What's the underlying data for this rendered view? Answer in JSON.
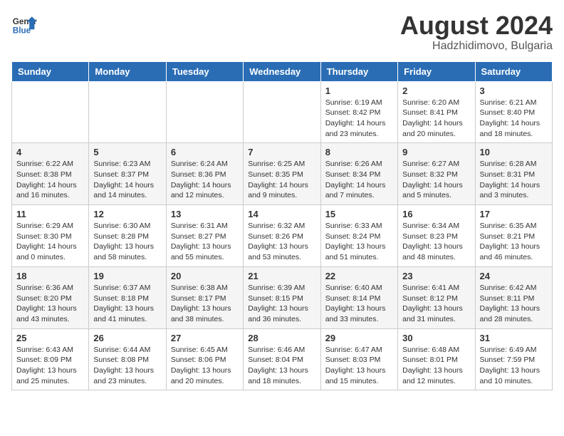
{
  "header": {
    "logo_general": "General",
    "logo_blue": "Blue",
    "month_year": "August 2024",
    "location": "Hadzhidimovo, Bulgaria"
  },
  "weekdays": [
    "Sunday",
    "Monday",
    "Tuesday",
    "Wednesday",
    "Thursday",
    "Friday",
    "Saturday"
  ],
  "weeks": [
    [
      {
        "day": "",
        "info": ""
      },
      {
        "day": "",
        "info": ""
      },
      {
        "day": "",
        "info": ""
      },
      {
        "day": "",
        "info": ""
      },
      {
        "day": "1",
        "info": "Sunrise: 6:19 AM\nSunset: 8:42 PM\nDaylight: 14 hours\nand 23 minutes."
      },
      {
        "day": "2",
        "info": "Sunrise: 6:20 AM\nSunset: 8:41 PM\nDaylight: 14 hours\nand 20 minutes."
      },
      {
        "day": "3",
        "info": "Sunrise: 6:21 AM\nSunset: 8:40 PM\nDaylight: 14 hours\nand 18 minutes."
      }
    ],
    [
      {
        "day": "4",
        "info": "Sunrise: 6:22 AM\nSunset: 8:38 PM\nDaylight: 14 hours\nand 16 minutes."
      },
      {
        "day": "5",
        "info": "Sunrise: 6:23 AM\nSunset: 8:37 PM\nDaylight: 14 hours\nand 14 minutes."
      },
      {
        "day": "6",
        "info": "Sunrise: 6:24 AM\nSunset: 8:36 PM\nDaylight: 14 hours\nand 12 minutes."
      },
      {
        "day": "7",
        "info": "Sunrise: 6:25 AM\nSunset: 8:35 PM\nDaylight: 14 hours\nand 9 minutes."
      },
      {
        "day": "8",
        "info": "Sunrise: 6:26 AM\nSunset: 8:34 PM\nDaylight: 14 hours\nand 7 minutes."
      },
      {
        "day": "9",
        "info": "Sunrise: 6:27 AM\nSunset: 8:32 PM\nDaylight: 14 hours\nand 5 minutes."
      },
      {
        "day": "10",
        "info": "Sunrise: 6:28 AM\nSunset: 8:31 PM\nDaylight: 14 hours\nand 3 minutes."
      }
    ],
    [
      {
        "day": "11",
        "info": "Sunrise: 6:29 AM\nSunset: 8:30 PM\nDaylight: 14 hours\nand 0 minutes."
      },
      {
        "day": "12",
        "info": "Sunrise: 6:30 AM\nSunset: 8:28 PM\nDaylight: 13 hours\nand 58 minutes."
      },
      {
        "day": "13",
        "info": "Sunrise: 6:31 AM\nSunset: 8:27 PM\nDaylight: 13 hours\nand 55 minutes."
      },
      {
        "day": "14",
        "info": "Sunrise: 6:32 AM\nSunset: 8:26 PM\nDaylight: 13 hours\nand 53 minutes."
      },
      {
        "day": "15",
        "info": "Sunrise: 6:33 AM\nSunset: 8:24 PM\nDaylight: 13 hours\nand 51 minutes."
      },
      {
        "day": "16",
        "info": "Sunrise: 6:34 AM\nSunset: 8:23 PM\nDaylight: 13 hours\nand 48 minutes."
      },
      {
        "day": "17",
        "info": "Sunrise: 6:35 AM\nSunset: 8:21 PM\nDaylight: 13 hours\nand 46 minutes."
      }
    ],
    [
      {
        "day": "18",
        "info": "Sunrise: 6:36 AM\nSunset: 8:20 PM\nDaylight: 13 hours\nand 43 minutes."
      },
      {
        "day": "19",
        "info": "Sunrise: 6:37 AM\nSunset: 8:18 PM\nDaylight: 13 hours\nand 41 minutes."
      },
      {
        "day": "20",
        "info": "Sunrise: 6:38 AM\nSunset: 8:17 PM\nDaylight: 13 hours\nand 38 minutes."
      },
      {
        "day": "21",
        "info": "Sunrise: 6:39 AM\nSunset: 8:15 PM\nDaylight: 13 hours\nand 36 minutes."
      },
      {
        "day": "22",
        "info": "Sunrise: 6:40 AM\nSunset: 8:14 PM\nDaylight: 13 hours\nand 33 minutes."
      },
      {
        "day": "23",
        "info": "Sunrise: 6:41 AM\nSunset: 8:12 PM\nDaylight: 13 hours\nand 31 minutes."
      },
      {
        "day": "24",
        "info": "Sunrise: 6:42 AM\nSunset: 8:11 PM\nDaylight: 13 hours\nand 28 minutes."
      }
    ],
    [
      {
        "day": "25",
        "info": "Sunrise: 6:43 AM\nSunset: 8:09 PM\nDaylight: 13 hours\nand 25 minutes."
      },
      {
        "day": "26",
        "info": "Sunrise: 6:44 AM\nSunset: 8:08 PM\nDaylight: 13 hours\nand 23 minutes."
      },
      {
        "day": "27",
        "info": "Sunrise: 6:45 AM\nSunset: 8:06 PM\nDaylight: 13 hours\nand 20 minutes."
      },
      {
        "day": "28",
        "info": "Sunrise: 6:46 AM\nSunset: 8:04 PM\nDaylight: 13 hours\nand 18 minutes."
      },
      {
        "day": "29",
        "info": "Sunrise: 6:47 AM\nSunset: 8:03 PM\nDaylight: 13 hours\nand 15 minutes."
      },
      {
        "day": "30",
        "info": "Sunrise: 6:48 AM\nSunset: 8:01 PM\nDaylight: 13 hours\nand 12 minutes."
      },
      {
        "day": "31",
        "info": "Sunrise: 6:49 AM\nSunset: 7:59 PM\nDaylight: 13 hours\nand 10 minutes."
      }
    ]
  ]
}
